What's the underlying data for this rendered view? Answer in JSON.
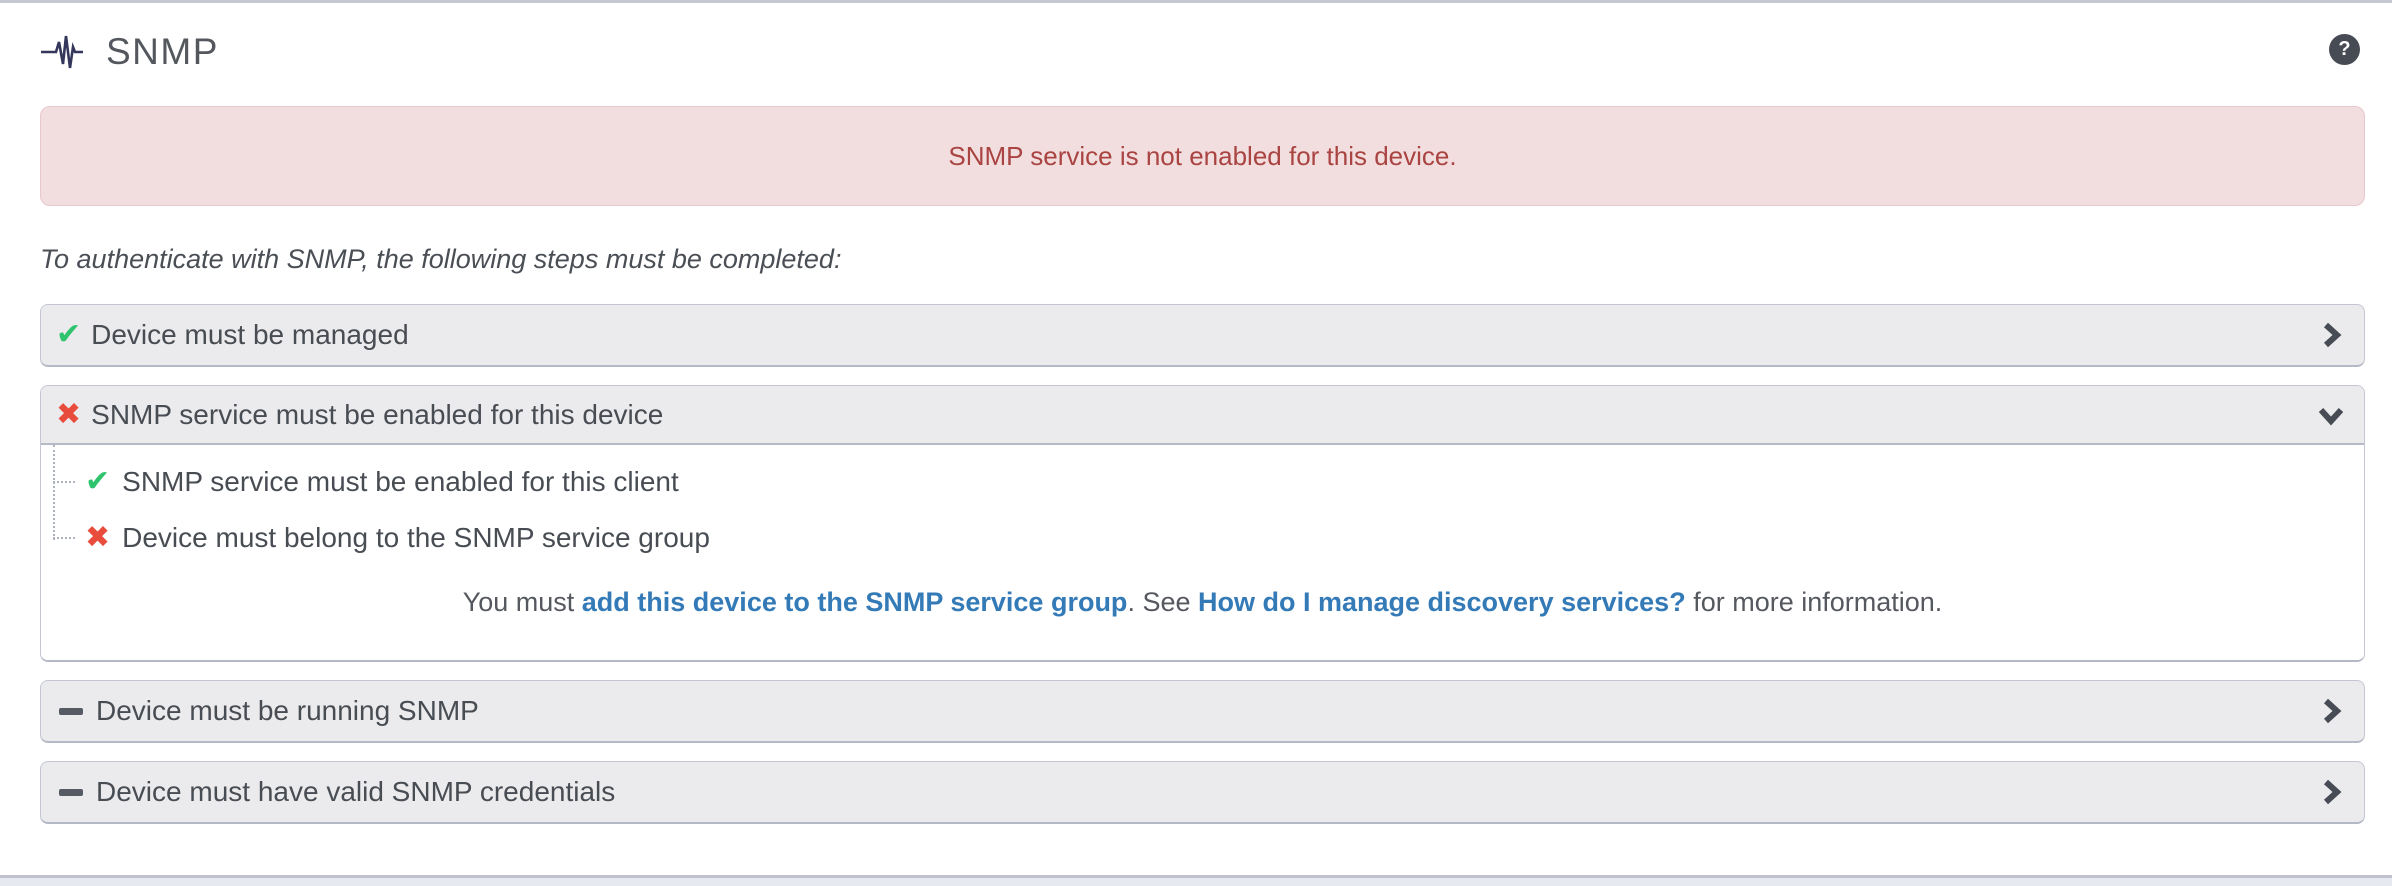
{
  "header": {
    "title": "SNMP",
    "help_icon_glyph": "?"
  },
  "alert": {
    "message": "SNMP service is not enabled for this device."
  },
  "intro_text": "To authenticate with SNMP, the following steps must be completed:",
  "icons": {
    "check": "✔",
    "cross": "✖",
    "pulse": "pulse-activity-icon",
    "minus": "minus-dash-icon",
    "chevron_right": "chevron-right-icon",
    "chevron_down": "chevron-down-icon"
  },
  "steps": [
    {
      "label": "Device must be managed",
      "status": "success",
      "state": "collapsed"
    },
    {
      "label": "SNMP service must be enabled for this device",
      "status": "error",
      "state": "expanded",
      "children": [
        {
          "label": "SNMP service must be enabled for this client",
          "status": "success"
        },
        {
          "label": "Device must belong to the SNMP service group",
          "status": "error"
        }
      ],
      "note": {
        "text_before": "You must ",
        "link_add_device": "add this device to the SNMP service group",
        "text_middle": ". See ",
        "link_manage_services": "How do I manage discovery services?",
        "text_after": " for more information."
      }
    },
    {
      "label": "Device must be running SNMP",
      "status": "unknown",
      "state": "collapsed"
    },
    {
      "label": "Device must have valid SNMP credentials",
      "status": "unknown",
      "state": "collapsed"
    }
  ],
  "colors": {
    "alert_bg": "#f2dede",
    "alert_text": "#a94442",
    "success": "#2fc36e",
    "error": "#e74c3c",
    "link": "#337ab7",
    "panel_header_bg": "#ebebed",
    "panel_border": "#c4c7d2",
    "text": "#484c53",
    "pulse_icon": "#34375b"
  }
}
